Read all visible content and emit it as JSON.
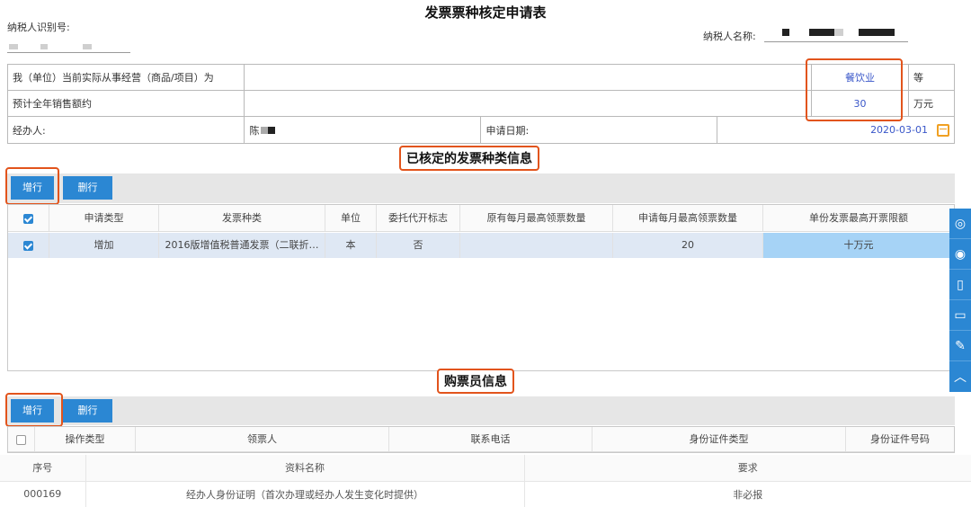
{
  "title": "发票票种核定申请表",
  "taxpayer_id_label": "纳税人识别号:",
  "taxpayer_name_label": "纳税人名称:",
  "form": {
    "row1_label": "我（单位）当前实际从事经营（商品/项目）为",
    "row1_value": "餐饮业",
    "row1_suffix": "等",
    "row2_label": "预计全年销售额约",
    "row2_value": "30",
    "row2_suffix": "万元",
    "row3_label": "经办人:",
    "row3_value": "陈",
    "date_label": "申请日期:",
    "date_value": "2020-03-01"
  },
  "section1": {
    "title": "已核定的发票种类信息",
    "add_label": "增行",
    "del_label": "删行",
    "columns": [
      "申请类型",
      "发票种类",
      "单位",
      "委托代开标志",
      "原有每月最高领票数量",
      "申请每月最高领票数量",
      "单份发票最高开票限额"
    ],
    "rows": [
      {
        "type": "增加",
        "kind": "2016版增值税普通发票（二联折…",
        "unit": "本",
        "flag": "否",
        "orig": "",
        "apply": "20",
        "limit": "十万元"
      }
    ]
  },
  "section2": {
    "title": "购票员信息",
    "add_label": "增行",
    "del_label": "删行",
    "columns": [
      "操作类型",
      "领票人",
      "联系电话",
      "身份证件类型",
      "身份证件号码"
    ]
  },
  "bottom": {
    "headers": [
      "序号",
      "资料名称",
      "要求"
    ],
    "rows": [
      {
        "no": "000169",
        "name": "经办人身份证明（首次办理或经办人发生变化时提供）",
        "req": "非必报"
      }
    ]
  },
  "side_icons": [
    "qq-icon",
    "weibo-icon",
    "mobile-icon",
    "tablet-icon",
    "edit-icon",
    "chevron-up-icon"
  ],
  "colors": {
    "accent": "#2b87d3",
    "highlight": "#e2541c",
    "link": "#3a57c9"
  }
}
